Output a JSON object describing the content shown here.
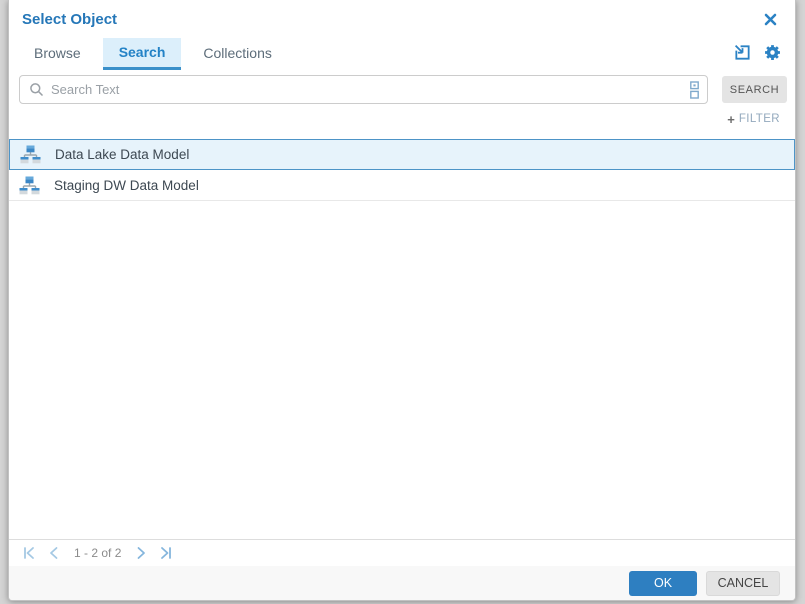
{
  "dialog": {
    "title": "Select Object"
  },
  "tabs": [
    {
      "label": "Browse",
      "active": false
    },
    {
      "label": "Search",
      "active": true
    },
    {
      "label": "Collections",
      "active": false
    }
  ],
  "header_icons": [
    {
      "name": "import-arrow-icon"
    },
    {
      "name": "gear-icon"
    },
    {
      "name": "close-icon"
    }
  ],
  "search": {
    "placeholder": "Search Text",
    "button_label": "SEARCH",
    "filter_plus": "+",
    "filter_label": "FILTER",
    "leading_icon": "search-icon",
    "trailing_icon": "structured-search-icon"
  },
  "list": {
    "items": [
      {
        "label": "Data Lake Data Model",
        "selected": true,
        "icon": "data-model-icon"
      },
      {
        "label": "Staging DW Data Model",
        "selected": false,
        "icon": "data-model-icon"
      }
    ]
  },
  "pagination": {
    "range_label": "1 - 2 of 2",
    "controls": [
      "first-page-icon",
      "previous-page-icon",
      "next-page-icon",
      "last-page-icon"
    ]
  },
  "footer": {
    "ok_label": "OK",
    "cancel_label": "CANCEL"
  },
  "colors": {
    "accent_blue": "#2577b8",
    "tab_active_bg": "#dceffb",
    "tab_underline": "#3a90ca",
    "selected_row_bg": "#e7f3fb",
    "selected_row_border": "#4d94c7",
    "ok_button": "#2e7fc1",
    "cancel_button": "#e4e4e4"
  }
}
